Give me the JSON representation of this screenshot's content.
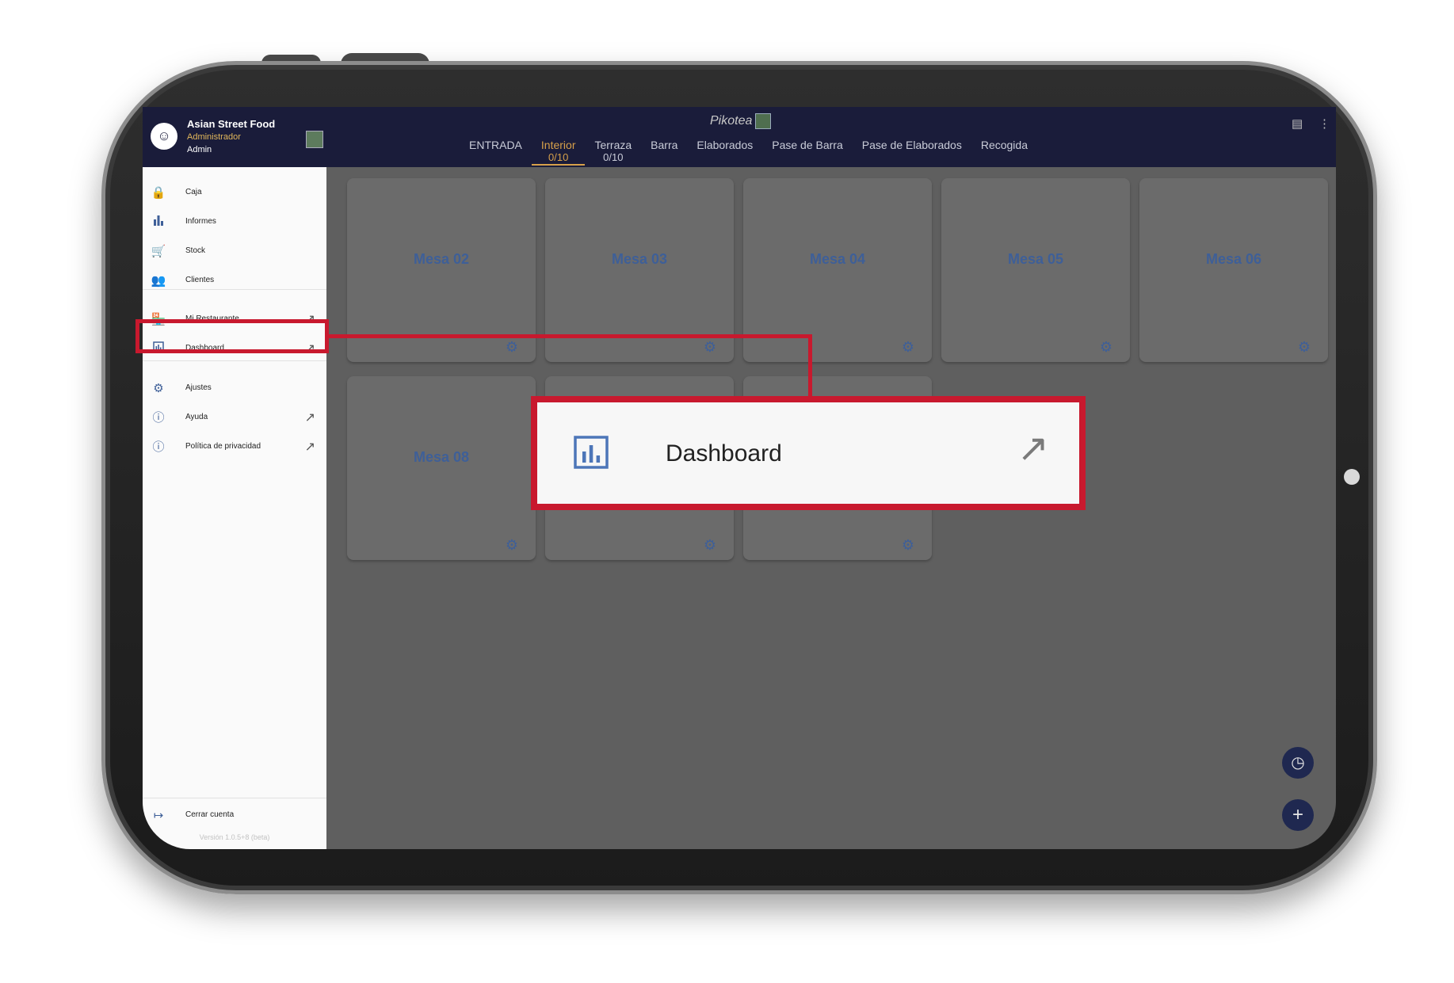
{
  "header": {
    "shop_name": "Asian Street Food",
    "role": "Administrador",
    "user": "Admin",
    "brand": "Pikotea"
  },
  "tabs": [
    {
      "label": "ENTRADA",
      "sub": ""
    },
    {
      "label": "Interior",
      "sub": "0/10",
      "active": true
    },
    {
      "label": "Terraza",
      "sub": "0/10"
    },
    {
      "label": "Barra",
      "sub": ""
    },
    {
      "label": "Elaborados",
      "sub": ""
    },
    {
      "label": "Pase de Barra",
      "sub": ""
    },
    {
      "label": "Pase de Elaborados",
      "sub": ""
    },
    {
      "label": "Recogida",
      "sub": ""
    }
  ],
  "tables": [
    {
      "name": "Mesa 02"
    },
    {
      "name": "Mesa 03"
    },
    {
      "name": "Mesa 04"
    },
    {
      "name": "Mesa 05"
    },
    {
      "name": "Mesa 06"
    },
    {
      "name": "Mesa 08"
    },
    {
      "name": ""
    },
    {
      "name": ""
    }
  ],
  "menu": {
    "caja": "Caja",
    "informes": "Informes",
    "stock": "Stock",
    "clientes": "Clientes",
    "mi_restaurante": "Mi Restaurante",
    "dashboard": "Dashboard",
    "ajustes": "Ajustes",
    "ayuda": "Ayuda",
    "privacidad": "Política de privacidad",
    "cerrar": "Cerrar cuenta",
    "version": "Versión 1.0.5+8 (beta)"
  },
  "callout": {
    "label": "Dashboard",
    "color": "#c8192e"
  },
  "colors": {
    "topbar": "#1a1c3a",
    "accent": "#d7a04a",
    "icon_blue": "#3e5f98"
  }
}
